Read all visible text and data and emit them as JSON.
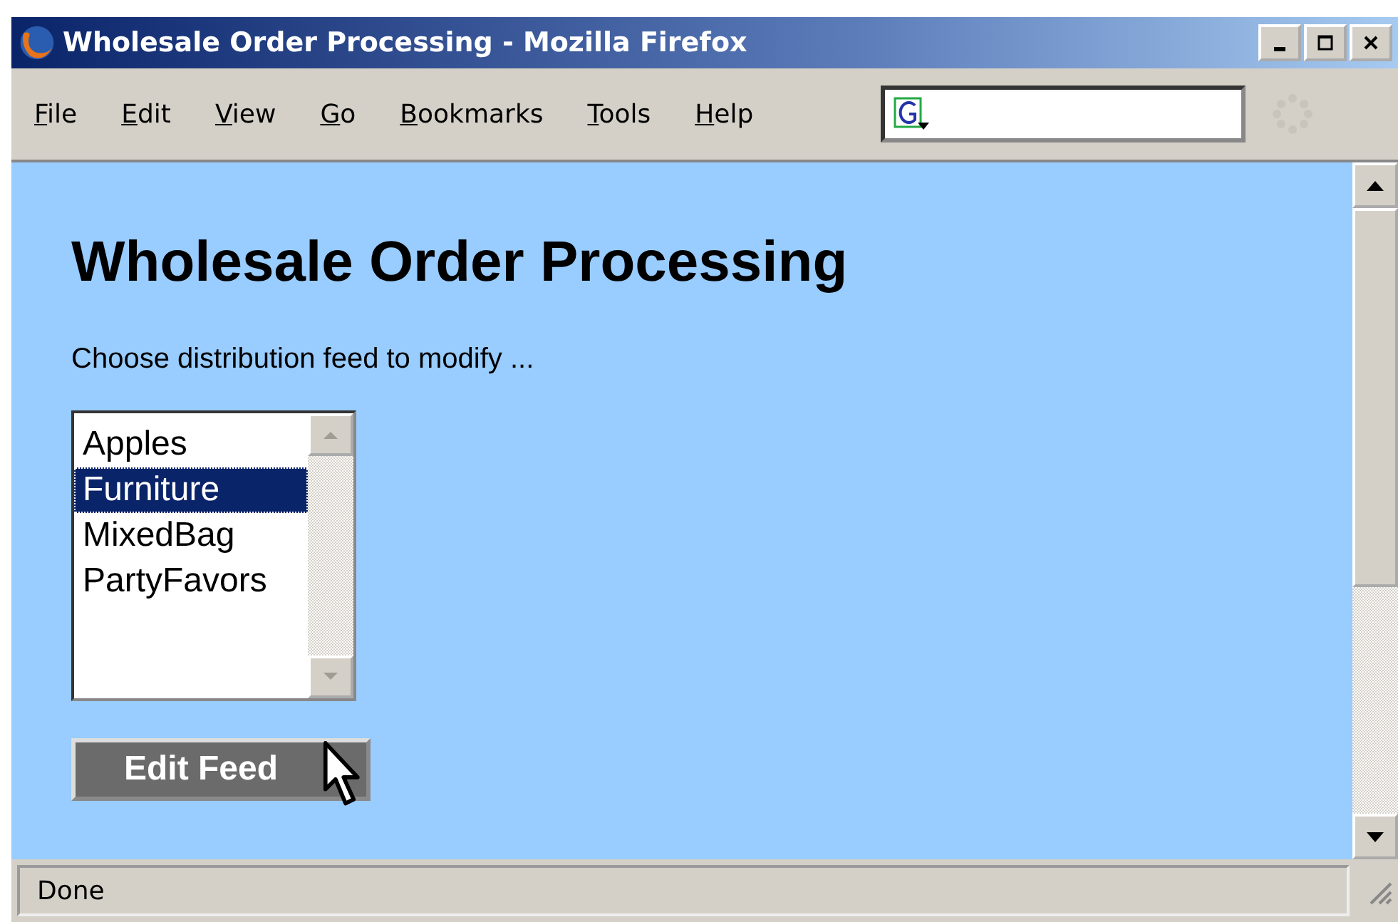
{
  "window": {
    "title": "Wholesale Order Processing - Mozilla Firefox"
  },
  "menu": [
    "File",
    "Edit",
    "View",
    "Go",
    "Bookmarks",
    "Tools",
    "Help"
  ],
  "page": {
    "heading": "Wholesale Order Processing",
    "prompt": "Choose distribution feed to modify ...",
    "feeds": [
      {
        "label": "Apples",
        "selected": false
      },
      {
        "label": "Furniture",
        "selected": true
      },
      {
        "label": "MixedBag",
        "selected": false
      },
      {
        "label": "PartyFavors",
        "selected": false
      }
    ],
    "button": "Edit Feed"
  },
  "status_bar": "Done"
}
